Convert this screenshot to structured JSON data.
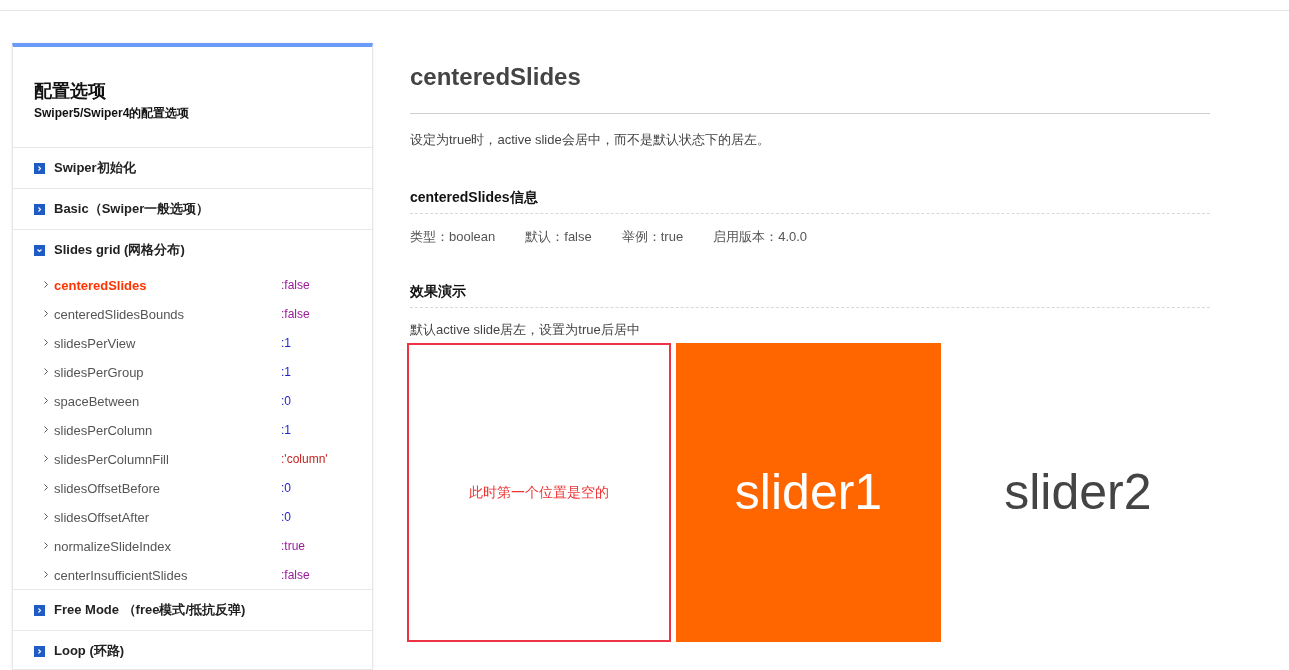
{
  "sidebar": {
    "title": "配置选项",
    "subtitle": "Swiper5/Swiper4的配置选项",
    "groups": [
      {
        "label": "Swiper初始化",
        "expanded": false
      },
      {
        "label": "Basic（Swiper一般选项）",
        "expanded": false
      },
      {
        "label": "Slides grid (网格分布)",
        "expanded": true,
        "items": [
          {
            "name": "centeredSlides",
            "value": ":false",
            "kind": "boolean",
            "selected": true
          },
          {
            "name": "centeredSlidesBounds",
            "value": ":false",
            "kind": "boolean",
            "selected": false
          },
          {
            "name": "slidesPerView",
            "value": ":1",
            "kind": "number",
            "selected": false
          },
          {
            "name": "slidesPerGroup",
            "value": ":1",
            "kind": "number",
            "selected": false
          },
          {
            "name": "spaceBetween",
            "value": ":0",
            "kind": "number",
            "selected": false
          },
          {
            "name": "slidesPerColumn",
            "value": ":1",
            "kind": "number",
            "selected": false
          },
          {
            "name": "slidesPerColumnFill",
            "value": ":'column'",
            "kind": "string",
            "selected": false
          },
          {
            "name": "slidesOffsetBefore",
            "value": ":0",
            "kind": "number",
            "selected": false
          },
          {
            "name": "slidesOffsetAfter",
            "value": ":0",
            "kind": "number",
            "selected": false
          },
          {
            "name": "normalizeSlideIndex",
            "value": ":true",
            "kind": "boolean",
            "selected": false
          },
          {
            "name": "centerInsufficientSlides",
            "value": ":false",
            "kind": "boolean",
            "selected": false
          }
        ]
      },
      {
        "label": "Free Mode （free模式/抵抗反弹)",
        "expanded": false
      },
      {
        "label": "Loop (环路)",
        "expanded": false
      }
    ]
  },
  "article": {
    "title": "centeredSlides",
    "description": "设定为true时，active slide会居中，而不是默认状态下的居左。",
    "sections": [
      {
        "heading": "centeredSlides信息",
        "info": [
          "类型：boolean",
          "默认：false",
          "举例：true",
          "启用版本：4.0.0"
        ]
      },
      {
        "heading": "效果演示",
        "caption": "默认active slide居左，设置为true后居中",
        "slides": [
          {
            "kind": "empty",
            "text": "此时第一个位置是空的"
          },
          {
            "kind": "slide",
            "label": "slider1",
            "active": true
          },
          {
            "kind": "slide",
            "label": "slider2",
            "active": false
          }
        ]
      }
    ]
  }
}
